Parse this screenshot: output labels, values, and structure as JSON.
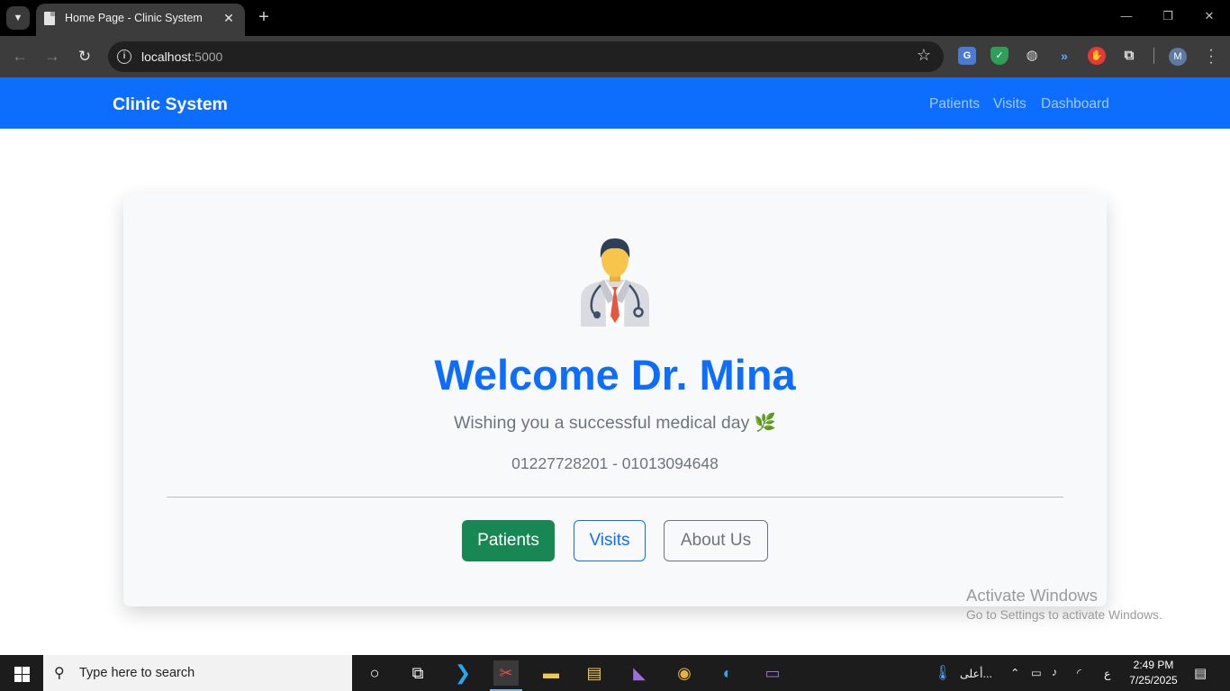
{
  "browser": {
    "tab_title": "Home Page - Clinic System",
    "url_host": "localhost",
    "url_port": ":5000",
    "profile_initial": "M"
  },
  "navbar": {
    "brand": "Clinic System",
    "links": [
      "Patients",
      "Visits",
      "Dashboard"
    ]
  },
  "hero": {
    "title": "Welcome Dr. Mina",
    "subtitle": "Wishing you a successful medical day 🌿",
    "phones": "01227728201 - 01013094648"
  },
  "buttons": {
    "patients": "Patients",
    "visits": "Visits",
    "about": "About Us"
  },
  "watermark": {
    "line1": "Activate Windows",
    "line2": "Go to Settings to activate Windows."
  },
  "taskbar": {
    "search_placeholder": "Type here to search",
    "weather_text": "أعلى...",
    "lang": "ع",
    "time": "2:49 PM",
    "date": "7/25/2025"
  },
  "colors": {
    "primary": "#0d6efd",
    "success": "#198754",
    "secondary": "#6c757d"
  }
}
